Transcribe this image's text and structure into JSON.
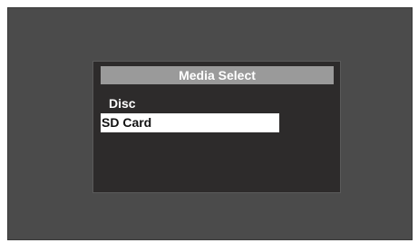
{
  "dialog": {
    "title": "Media Select",
    "items": [
      {
        "label": "Disc",
        "selected": false
      },
      {
        "label": "SD Card",
        "selected": true
      }
    ]
  },
  "colors": {
    "screen_background": "#4b4b4b",
    "dialog_background": "#2d2b2b",
    "title_bar": "#9a9a9a",
    "highlight": "#ffffff"
  }
}
